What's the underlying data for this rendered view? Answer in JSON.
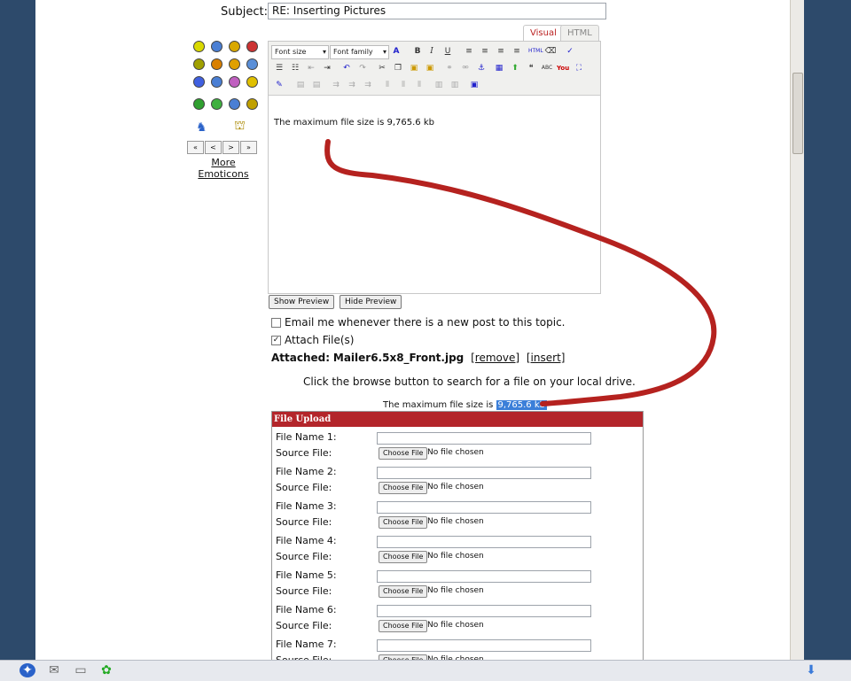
{
  "form": {
    "subject_label": "Subject:",
    "subject_value": "RE: Inserting Pictures",
    "tabs": [
      "Visual",
      "HTML"
    ],
    "toolbar": {
      "font_size": "Font size",
      "font_family": "Font family"
    },
    "editor_text": "The maximum file size is 9,765.6 kb",
    "show_preview": "Show Preview",
    "hide_preview": "Hide Preview",
    "email_me_label": "Email me whenever there is a new post to this topic.",
    "email_me_checked": false,
    "attach_label": "Attach File(s)",
    "attach_checked": true,
    "attached_label": "Attached:",
    "attached_file": "Mailer6.5x8_Front.jpg",
    "remove_link": "[remove]",
    "insert_link": "[insert]",
    "help_text": "Click the browse button to search for a file on your local drive.",
    "max_size_prefix": "The maximum file size is",
    "max_size_value": "9,765.6 kb"
  },
  "emoticons": {
    "pager": [
      "«",
      "<",
      ">",
      "»"
    ],
    "more_link": "More Emoticons",
    "colors": [
      "#d9d900",
      "#4a7fd4",
      "#d9a800",
      "#c33",
      "#a0a000",
      "#d98000",
      "#e0a000",
      "#5a8fd8",
      "#4060e0",
      "#4a7fd4",
      "#c060c0",
      "#e0c000",
      "#30a030",
      "#40b040",
      "#4a7fd4",
      "#c0a000"
    ]
  },
  "upload": {
    "title": "File Upload",
    "choose_label": "Choose File",
    "no_file": "No file chosen",
    "source_label": "Source File:",
    "rows": [
      "File Name 1:",
      "File Name 2:",
      "File Name 3:",
      "File Name 4:",
      "File Name 5:",
      "File Name 6:",
      "File Name 7:"
    ]
  },
  "taskbar": {
    "icons": [
      "start-orb-icon",
      "mail-icon",
      "chat-icon",
      "plugin-icon",
      "download-arrow-icon"
    ]
  }
}
